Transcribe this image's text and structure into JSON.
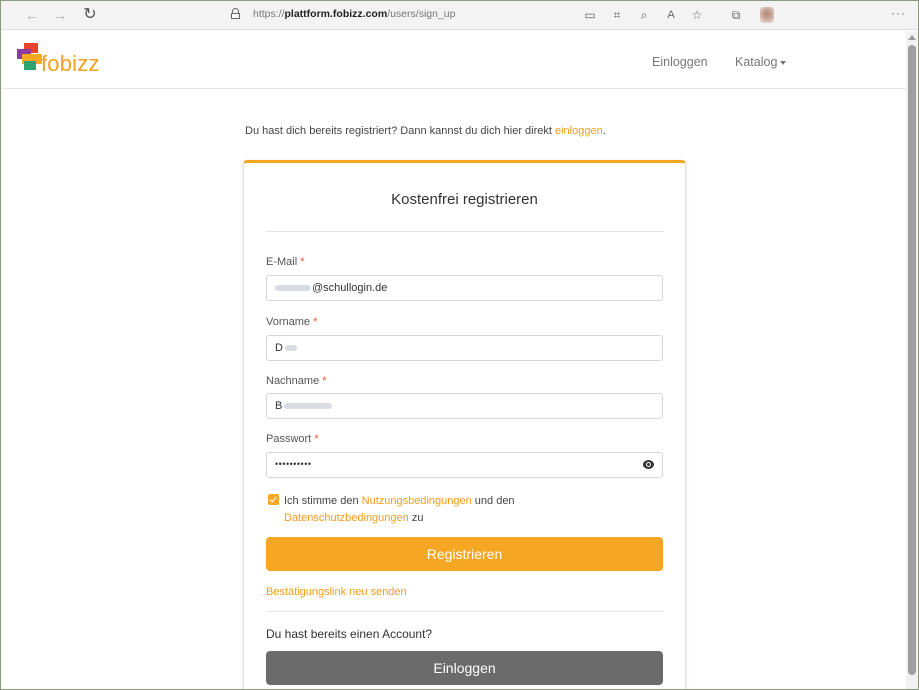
{
  "browser": {
    "nav_back": "←",
    "nav_forward": "→",
    "nav_reload": "↻",
    "url_prefix": "https://",
    "url_host": "plattform.fobizz.com",
    "url_path": "/users/sign_up",
    "toolbar_icons": [
      "read-aloud-icon",
      "split-screen-icon",
      "search-icon",
      "text-size-icon",
      "favorites-icon",
      "collections-icon",
      "profile-avatar"
    ],
    "toolbar_glyphs": [
      "▭",
      "⌗",
      "⌕",
      "A",
      "☆",
      "⧉"
    ],
    "more": "···"
  },
  "header": {
    "logo_text": "fobizz",
    "nav_login": "Einloggen",
    "nav_katalog": "Katalog"
  },
  "intro": {
    "text": "Du hast dich bereits registriert? Dann kannst du dich hier direkt ",
    "link": "einloggen",
    "suffix": "."
  },
  "form": {
    "title": "Kostenfrei registrieren",
    "email_label": "E-Mail",
    "email_value": "@schullogin.de",
    "firstname_label": "Vorname",
    "firstname_value": "D",
    "lastname_label": "Nachname",
    "lastname_value": "B",
    "password_label": "Passwort",
    "password_value": "••••••••••",
    "required_marker": "*",
    "terms_prefix": "Ich stimme den ",
    "terms_link1": "Nutzungsbedingungen",
    "terms_middle": " und den ",
    "terms_link2": "Datenschutzbedingungen",
    "terms_suffix": " zu",
    "terms_checked": true,
    "register_button": "Registrieren",
    "resend_link": "Bestätigungslink neu senden",
    "account_text": "Du hast bereits einen Account?",
    "login_button": "Einloggen"
  },
  "colors": {
    "accent": "#f5a623",
    "link": "#f59c1a",
    "required": "#e8522e",
    "login_button": "#6b6b6b"
  }
}
